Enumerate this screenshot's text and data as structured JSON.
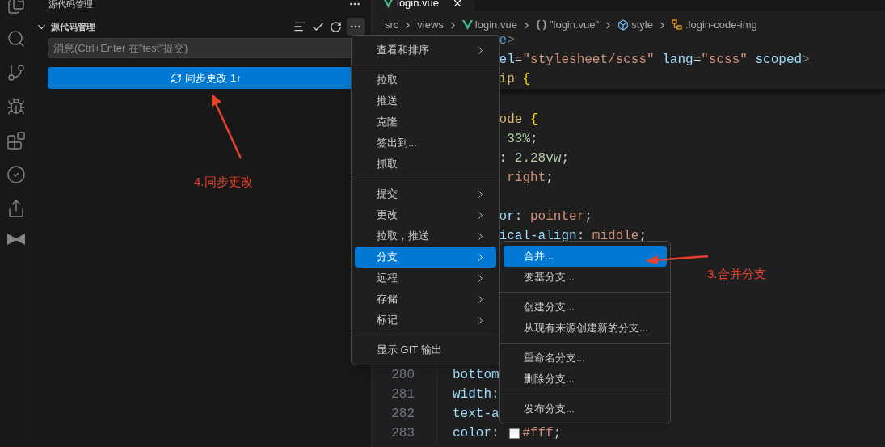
{
  "sidebar": {
    "title": "源代码管理",
    "section": {
      "title": "源代码管理",
      "expanded": true
    },
    "message_field": {
      "placeholder": "消息(Ctrl+Enter 在\"test\"提交)"
    },
    "sync_button": {
      "label": "同步更改 1↑"
    }
  },
  "editor": {
    "tabs": [
      {
        "label": "login.vue",
        "selected": true
      }
    ],
    "breadcrumb": [
      {
        "text": "src"
      },
      {
        "text": "views"
      },
      {
        "text": "login.vue"
      },
      {
        "text": "\"login.vue\""
      },
      {
        "text": "style"
      },
      {
        "text": ".login-code-img"
      }
    ],
    "sticky_lines": [
      {
        "kind": "code",
        "tokens": [
          {
            "text": "      e",
            "kind": "tag"
          },
          {
            "text": ">",
            "kind": "punct"
          }
        ]
      },
      {
        "kind": "code",
        "tokens": [
          {
            "text": "      el",
            "kind": "attr"
          },
          {
            "text": "=",
            "kind": "plain"
          },
          {
            "text": "\"stylesheet/scss\"",
            "kind": "string"
          },
          {
            "text": " lang",
            "kind": "attr"
          },
          {
            "text": "=",
            "kind": "plain"
          },
          {
            "text": "\"scss\"",
            "kind": "string"
          },
          {
            "text": " scoped",
            "kind": "attr"
          },
          {
            "text": ">",
            "kind": "punct"
          }
        ]
      },
      {
        "kind": "code",
        "tokens": [
          {
            "text": "      ip ",
            "kind": "selector"
          },
          {
            "text": "{",
            "kind": "brace"
          }
        ]
      }
    ],
    "lines": [
      {
        "kind": "blank"
      },
      {
        "kind": "code",
        "tokens": [
          {
            "text": "      ode ",
            "kind": "selector"
          },
          {
            "text": "{",
            "kind": "brace"
          }
        ]
      },
      {
        "kind": "code",
        "tokens": [
          {
            "text": "       33%",
            "kind": "number"
          },
          {
            "text": ";",
            "kind": "plain"
          }
        ]
      },
      {
        "kind": "code",
        "tokens": [
          {
            "text": "      : ",
            "kind": "plain"
          },
          {
            "text": "2.28vw",
            "kind": "number"
          },
          {
            "text": ";",
            "kind": "plain"
          }
        ]
      },
      {
        "kind": "code",
        "tokens": [
          {
            "text": "       right",
            "kind": "value"
          },
          {
            "text": ";",
            "kind": "plain"
          }
        ]
      },
      {
        "kind": "blank"
      },
      {
        "kind": "code",
        "tokens": [
          {
            "text": "      or",
            "kind": "property"
          },
          {
            "text": ": ",
            "kind": "plain"
          },
          {
            "text": "pointer",
            "kind": "value"
          },
          {
            "text": ";",
            "kind": "plain"
          }
        ]
      },
      {
        "kind": "code",
        "tokens": [
          {
            "text": "      ical-align",
            "kind": "property"
          },
          {
            "text": ": ",
            "kind": "plain"
          },
          {
            "text": "middle",
            "kind": "value"
          },
          {
            "text": ";",
            "kind": "plain"
          }
        ]
      }
    ],
    "bottom_lines": [
      {
        "kind": "code",
        "number": "280",
        "tokens": [
          {
            "text": "bottom",
            "kind": "property"
          }
        ]
      },
      {
        "kind": "code",
        "number": "281",
        "tokens": [
          {
            "text": "width:",
            "kind": "property"
          }
        ]
      },
      {
        "kind": "code",
        "number": "282",
        "tokens": [
          {
            "text": "text-a",
            "kind": "property"
          }
        ]
      },
      {
        "kind": "code",
        "number": "283",
        "tokens": [
          {
            "text": "color",
            "kind": "property"
          },
          {
            "text": ": ",
            "kind": "plain"
          },
          {
            "kind": "swatch",
            "color": "#ffffff"
          },
          {
            "text": "#fff",
            "kind": "value"
          },
          {
            "text": ";",
            "kind": "plain"
          }
        ]
      }
    ]
  },
  "context_menu": {
    "groups": [
      [
        {
          "label": "查看和排序",
          "has_submenu": true,
          "selected": false
        }
      ],
      [
        {
          "label": "拉取",
          "has_submenu": false,
          "selected": false
        },
        {
          "label": "推送",
          "has_submenu": false,
          "selected": false
        },
        {
          "label": "克隆",
          "has_submenu": false,
          "selected": false
        },
        {
          "label": "签出到...",
          "has_submenu": false,
          "selected": false
        },
        {
          "label": "抓取",
          "has_submenu": false,
          "selected": false
        }
      ],
      [
        {
          "label": "提交",
          "has_submenu": true,
          "selected": false
        },
        {
          "label": "更改",
          "has_submenu": true,
          "selected": false
        },
        {
          "label": "拉取，推送",
          "has_submenu": true,
          "selected": false
        },
        {
          "label": "分支",
          "has_submenu": true,
          "selected": true
        },
        {
          "label": "远程",
          "has_submenu": true,
          "selected": false
        },
        {
          "label": "存储",
          "has_submenu": true,
          "selected": false
        },
        {
          "label": "标记",
          "has_submenu": true,
          "selected": false
        }
      ],
      [
        {
          "label": "显示 GIT 输出",
          "has_submenu": false,
          "selected": false
        }
      ]
    ]
  },
  "submenu": {
    "groups": [
      [
        {
          "label": "合并...",
          "selected": true
        },
        {
          "label": "变基分支...",
          "selected": false
        }
      ],
      [
        {
          "label": "创建分支...",
          "selected": false
        },
        {
          "label": "从现有来源创建新的分支...",
          "selected": false
        }
      ],
      [
        {
          "label": "重命名分支...",
          "selected": false
        },
        {
          "label": "删除分支...",
          "selected": false
        }
      ],
      [
        {
          "label": "发布分支...",
          "selected": false
        }
      ]
    ]
  },
  "annotations": [
    {
      "text": "4.同步更改"
    },
    {
      "text": "3.合并分支"
    }
  ]
}
